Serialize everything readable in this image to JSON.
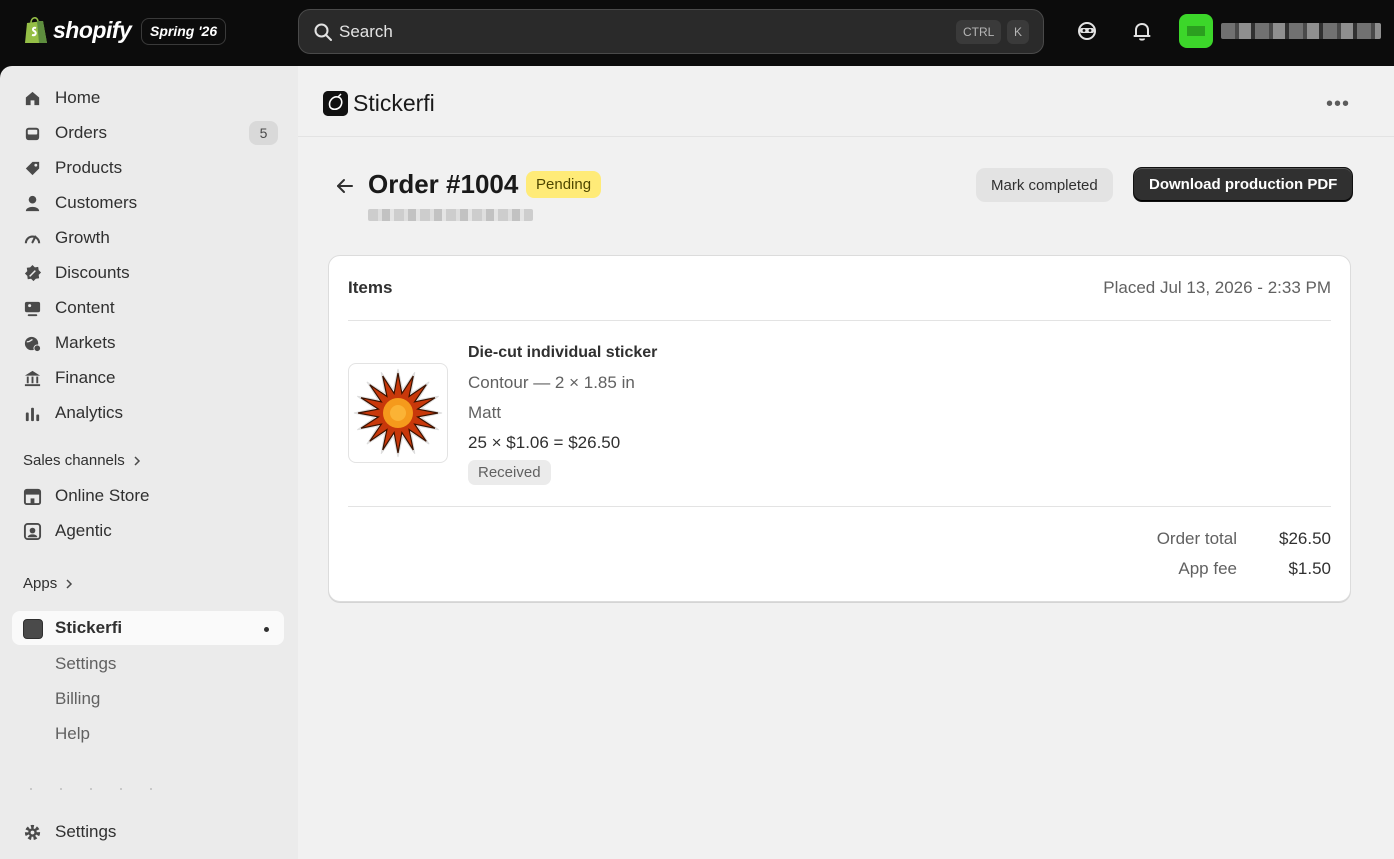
{
  "topbar": {
    "brand": "shopify",
    "edition": "Spring '26",
    "search_placeholder": "Search",
    "shortcut_ctrl": "CTRL",
    "shortcut_k": "K"
  },
  "sidebar": {
    "items": [
      {
        "label": "Home",
        "icon": "home-icon"
      },
      {
        "label": "Orders",
        "icon": "orders-icon",
        "badge": "5"
      },
      {
        "label": "Products",
        "icon": "tag-icon"
      },
      {
        "label": "Customers",
        "icon": "person-icon"
      },
      {
        "label": "Growth",
        "icon": "gauge-icon"
      },
      {
        "label": "Discounts",
        "icon": "discount-icon"
      },
      {
        "label": "Content",
        "icon": "content-icon"
      },
      {
        "label": "Markets",
        "icon": "globe-icon"
      },
      {
        "label": "Finance",
        "icon": "bank-icon"
      },
      {
        "label": "Analytics",
        "icon": "bar-chart-icon"
      }
    ],
    "sales_channels_label": "Sales channels",
    "channels": [
      {
        "label": "Online Store",
        "icon": "store-icon"
      },
      {
        "label": "Agentic",
        "icon": "agentic-icon"
      }
    ],
    "apps_label": "Apps",
    "app_name": "Stickerfi",
    "app_subitems": [
      "Settings",
      "Billing",
      "Help"
    ],
    "settings_label": "Settings"
  },
  "app_header": {
    "title": "Stickerfi"
  },
  "order": {
    "title": "Order #1004",
    "status": "Pending",
    "mark_completed": "Mark completed",
    "download_pdf": "Download production PDF"
  },
  "card": {
    "title": "Items",
    "placed": "Placed Jul 13, 2026 - 2:33 PM",
    "item": {
      "name": "Die-cut individual sticker",
      "shape": "Contour — 2 × 1.85 in",
      "customer": "Matt",
      "pricing": "25 × $1.06 = $26.50",
      "status": "Received"
    },
    "totals": [
      {
        "label": "Order total",
        "value": "$26.50"
      },
      {
        "label": "App fee",
        "value": "$1.50"
      }
    ]
  },
  "colors": {
    "topbar_bg": "#0c0c0c",
    "sidebar_bg": "#ebebeb",
    "main_bg": "#f1f1f1",
    "pending_bg": "#ffeb78",
    "primary_btn": "#303030",
    "avatar": "#3cd62a"
  }
}
